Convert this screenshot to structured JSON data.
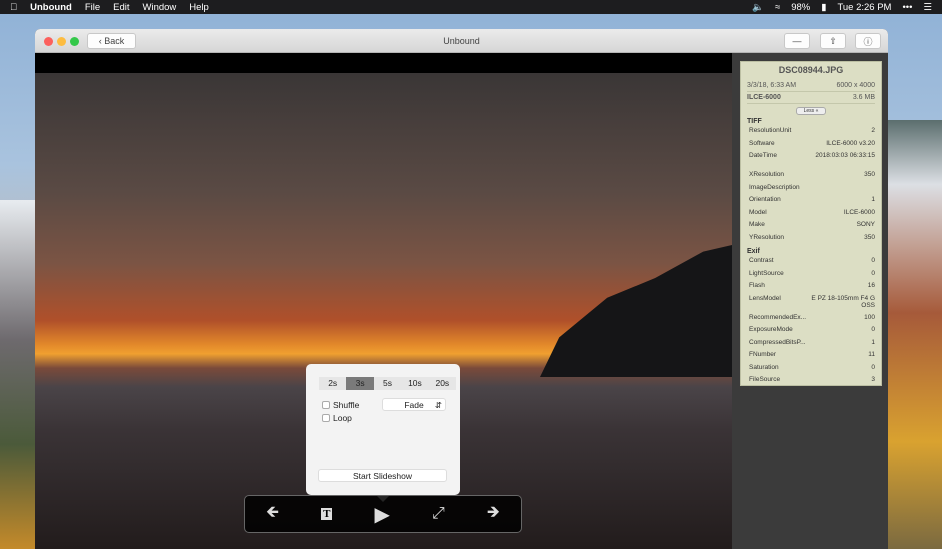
{
  "menubar": {
    "app": "Unbound",
    "items": [
      "File",
      "Edit",
      "Window",
      "Help"
    ],
    "battery": "98%",
    "clock": "Tue 2:26 PM"
  },
  "window": {
    "title": "Unbound",
    "back": "Back"
  },
  "info": {
    "filename": "DSC08944.JPG",
    "date": "3/3/18, 6:33 AM",
    "dimensions": "6000 x 4000",
    "camera": "ILCE-6000",
    "size": "3.6 MB",
    "less": "Less «",
    "sections": [
      {
        "title": "TIFF",
        "rows": [
          [
            "ResolutionUnit",
            "2"
          ],
          [
            "Software",
            "ILCE-6000 v3.20"
          ],
          [
            "DateTime",
            "2018:03:03 06:33:15"
          ],
          [
            "XResolution",
            "350"
          ],
          [
            "ImageDescription",
            ""
          ],
          [
            "Orientation",
            "1"
          ],
          [
            "Model",
            "ILCE-6000"
          ],
          [
            "Make",
            "SONY"
          ],
          [
            "YResolution",
            "350"
          ]
        ]
      },
      {
        "title": "Exif",
        "rows": [
          [
            "Contrast",
            "0"
          ],
          [
            "LightSource",
            "0"
          ],
          [
            "Flash",
            "16"
          ],
          [
            "LensModel",
            "E PZ 18-105mm F4 G OSS"
          ],
          [
            "RecommendedEx...",
            "100"
          ],
          [
            "ExposureMode",
            "0"
          ],
          [
            "CompressedBitsP...",
            "1"
          ],
          [
            "FNumber",
            "11"
          ],
          [
            "Saturation",
            "0"
          ],
          [
            "FileSource",
            "3"
          ]
        ]
      }
    ]
  },
  "slideshow": {
    "intervals": [
      "2s",
      "3s",
      "5s",
      "10s",
      "20s"
    ],
    "selected": "3s",
    "shuffle": "Shuffle",
    "loop": "Loop",
    "transition": "Fade",
    "start": "Start Slideshow"
  }
}
